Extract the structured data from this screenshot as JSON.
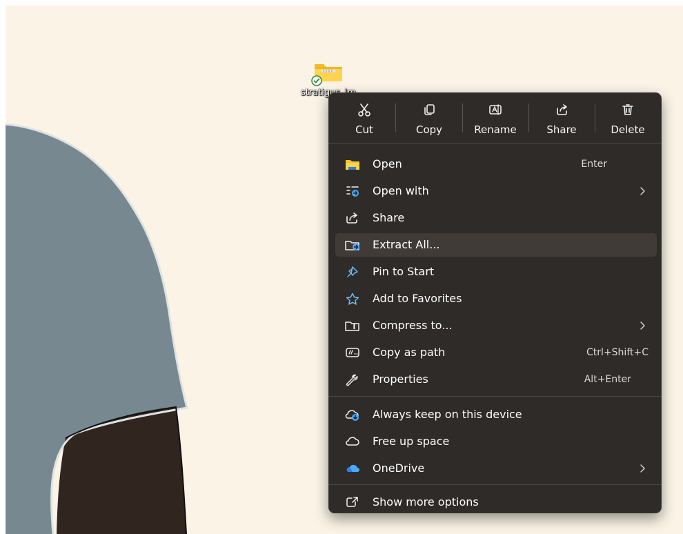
{
  "desktop": {
    "icon_label": "stratigus_lm",
    "icons": {
      "folder": "zip-folder-icon",
      "badge": "sync-check-icon"
    }
  },
  "context_menu": {
    "quick_actions": [
      {
        "label": "Cut",
        "icon": "scissors-icon"
      },
      {
        "label": "Copy",
        "icon": "copy-icon"
      },
      {
        "label": "Rename",
        "icon": "rename-icon"
      },
      {
        "label": "Share",
        "icon": "share-icon"
      },
      {
        "label": "Delete",
        "icon": "trash-icon"
      }
    ],
    "items": [
      {
        "label": "Open",
        "shortcut": "Enter",
        "icon": "folder-icon"
      },
      {
        "label": "Open with",
        "icon": "open-with-icon",
        "submenu": true
      },
      {
        "label": "Share",
        "icon": "share-icon"
      },
      {
        "label": "Extract All...",
        "icon": "extract-icon",
        "highlighted": true
      },
      {
        "label": "Pin to Start",
        "icon": "pin-icon"
      },
      {
        "label": "Add to Favorites",
        "icon": "star-icon"
      },
      {
        "label": "Compress to...",
        "icon": "compress-folder-icon",
        "submenu": true
      },
      {
        "label": "Copy as path",
        "shortcut": "Ctrl+Shift+C",
        "icon": "path-icon"
      },
      {
        "label": "Properties",
        "shortcut": "Alt+Enter",
        "icon": "wrench-icon"
      },
      {
        "label": "Always keep on this device",
        "icon": "cloud-download-icon"
      },
      {
        "label": "Free up space",
        "icon": "cloud-icon"
      },
      {
        "label": "OneDrive",
        "icon": "onedrive-cloud-icon",
        "submenu": true
      },
      {
        "label": "Show more options",
        "icon": "external-options-icon"
      }
    ]
  },
  "colors": {
    "desktop_background": "#fbf4e6",
    "menu_background": "#2f2b28",
    "menu_hover": "#403b37",
    "accent_blue": "#4ca9ff",
    "folder_yellow": "#f4c430",
    "shirt_gray": "#778891",
    "skin_dark": "#31261f"
  }
}
